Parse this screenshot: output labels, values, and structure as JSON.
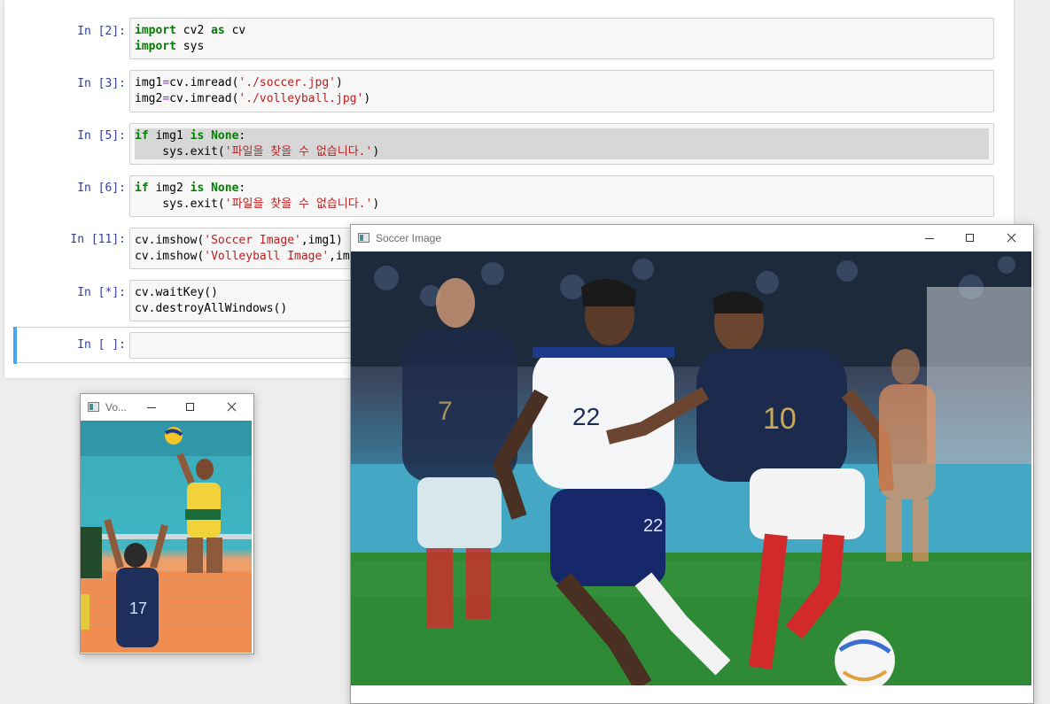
{
  "cells": [
    {
      "prompt": "In [2]:",
      "lines": [
        [
          {
            "t": "import",
            "c": "kw"
          },
          {
            "t": " cv2 "
          },
          {
            "t": "as",
            "c": "kw"
          },
          {
            "t": " cv"
          }
        ],
        [
          {
            "t": "import",
            "c": "kw"
          },
          {
            "t": " sys"
          }
        ]
      ]
    },
    {
      "prompt": "In [3]:",
      "lines": [
        [
          {
            "t": "img1"
          },
          {
            "t": "=",
            "c": "op"
          },
          {
            "t": "cv.imread("
          },
          {
            "t": "'./soccer.jpg'",
            "c": "str"
          },
          {
            "t": ")"
          }
        ],
        [
          {
            "t": "img2"
          },
          {
            "t": "=",
            "c": "op"
          },
          {
            "t": "cv.imread("
          },
          {
            "t": "'./volleyball.jpg'",
            "c": "str"
          },
          {
            "t": ")"
          }
        ]
      ]
    },
    {
      "prompt": "In [5]:",
      "lines": [
        [
          {
            "t": "if",
            "c": "kw"
          },
          {
            "t": " img1 "
          },
          {
            "t": "is",
            "c": "kw"
          },
          {
            "t": " "
          },
          {
            "t": "None",
            "c": "kw"
          },
          {
            "t": ":"
          }
        ],
        [
          {
            "t": "    sys.exit("
          },
          {
            "t": "'파일을 찾을 수 없습니다.'",
            "c": "str"
          },
          {
            "t": ")"
          }
        ]
      ],
      "highlight": true
    },
    {
      "prompt": "In [6]:",
      "lines": [
        [
          {
            "t": "if",
            "c": "kw"
          },
          {
            "t": " img2 "
          },
          {
            "t": "is",
            "c": "kw"
          },
          {
            "t": " "
          },
          {
            "t": "None",
            "c": "kw"
          },
          {
            "t": ":"
          }
        ],
        [
          {
            "t": "    sys.exit("
          },
          {
            "t": "'파일을 찾을 수 없습니다.'",
            "c": "str"
          },
          {
            "t": ")"
          }
        ]
      ]
    },
    {
      "prompt": "In [11]:",
      "lines": [
        [
          {
            "t": "cv.imshow("
          },
          {
            "t": "'Soccer Image'",
            "c": "str"
          },
          {
            "t": ",img1)"
          }
        ],
        [
          {
            "t": "cv.imshow("
          },
          {
            "t": "'Volleyball Image'",
            "c": "str"
          },
          {
            "t": ",img2)"
          }
        ]
      ]
    },
    {
      "prompt": "In [*]:",
      "lines": [
        [
          {
            "t": "cv.waitKey()"
          }
        ],
        [
          {
            "t": "cv.destroyAllWindows()"
          }
        ]
      ]
    },
    {
      "prompt": "In [ ]:",
      "lines": [
        [
          {
            "t": ""
          }
        ]
      ]
    }
  ],
  "soccer_window": {
    "title": "Soccer Image"
  },
  "volleyball_window": {
    "title": "Vo..."
  },
  "colors": {
    "prompt": "#303f9f",
    "keyword": "#008000",
    "string": "#ba2121",
    "active_bar": "#42a5f5"
  }
}
